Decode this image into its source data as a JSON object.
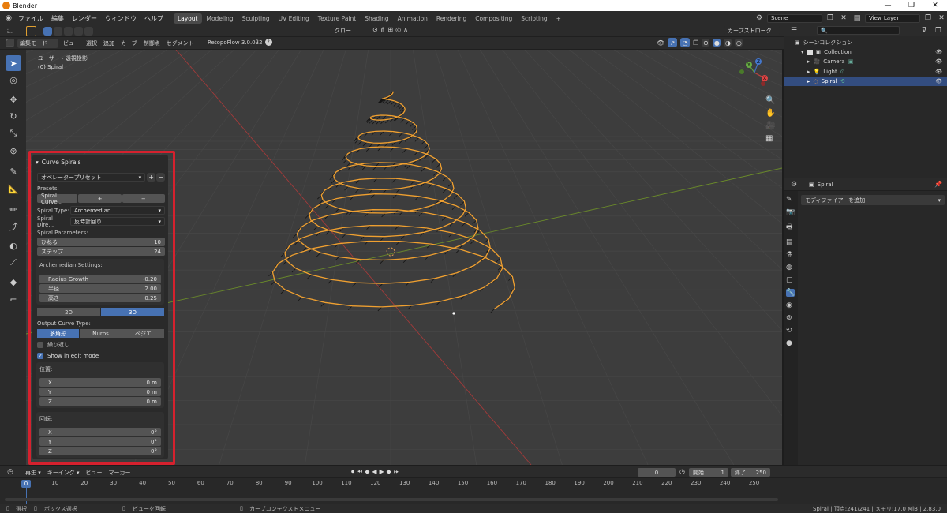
{
  "window": {
    "title": "Blender",
    "minimize": "—",
    "maximize": "❐",
    "close": "✕"
  },
  "menus": [
    "ファイル",
    "編集",
    "レンダー",
    "ウィンドウ",
    "ヘルプ"
  ],
  "workspaces": [
    "Layout",
    "Modeling",
    "Sculpting",
    "UV Editing",
    "Texture Paint",
    "Shading",
    "Animation",
    "Rendering",
    "Compositing",
    "Scripting",
    "+"
  ],
  "scene": {
    "label": "Scene",
    "view_layer": "View Layer"
  },
  "viewport_header": {
    "mode": "編集モード",
    "menus": [
      "ビュー",
      "選択",
      "追加",
      "カーブ",
      "制御点",
      "セグメント"
    ],
    "addon": "RetopoFlow 3.0.0β2",
    "help": "?",
    "transform": "グロー...",
    "tilt": "カーブストローク"
  },
  "viewport": {
    "view_name": "ユーザー・透視投影",
    "object": "(0) Spiral",
    "axes": {
      "x": "X",
      "y": "Y",
      "z": "Z"
    }
  },
  "operator_panel": {
    "title": "Curve Spirals",
    "preset_label": "オペレータープリセット",
    "presets_label": "Presets:",
    "preset_value": "Spiral Curve...",
    "preset_add": "+",
    "preset_remove": "−",
    "spiral_type_label": "Spiral Type:",
    "spiral_type": "Archemedian",
    "spiral_dir_label": "Spiral Dire...",
    "spiral_dir": "反時計回り",
    "params_label": "Spiral Parameters:",
    "turns_label": "ひねる",
    "turns": "10",
    "steps_label": "ステップ",
    "steps": "24",
    "arch_label": "Archemedian Settings:",
    "growth_label": "Radius Growth",
    "growth": "-0.20",
    "radius_label": "半径",
    "radius": "2.00",
    "height_label": "高さ",
    "height": "0.25",
    "mode_2d": "2D",
    "mode_3d": "3D",
    "output_label": "Output Curve Type:",
    "out_poly": "多角形",
    "out_nurbs": "Nurbs",
    "out_bezier": "ベジエ",
    "cyclic_label": "繰り返し",
    "show_edit_label": "Show in edit mode",
    "location_label": "位置:",
    "loc": [
      {
        "k": "X",
        "v": "0 m"
      },
      {
        "k": "Y",
        "v": "0 m"
      },
      {
        "k": "Z",
        "v": "0 m"
      }
    ],
    "rotation_label": "回転:",
    "rot": [
      {
        "k": "X",
        "v": "0°"
      },
      {
        "k": "Y",
        "v": "0°"
      },
      {
        "k": "Z",
        "v": "0°"
      }
    ]
  },
  "outliner": {
    "root": "シーンコレクション",
    "items": [
      {
        "name": "Collection"
      },
      {
        "name": "Camera"
      },
      {
        "name": "Light"
      },
      {
        "name": "Spiral"
      }
    ]
  },
  "properties": {
    "object": "Spiral",
    "add_modifier": "モディファイアーを追加"
  },
  "timeline": {
    "menus": [
      "再生",
      "キーイング",
      "ビュー",
      "マーカー"
    ],
    "current": "0",
    "start_label": "開始",
    "start": "1",
    "end_label": "終了",
    "end": "250",
    "ticks": [
      "0",
      "10",
      "20",
      "30",
      "40",
      "50",
      "60",
      "70",
      "80",
      "90",
      "100",
      "110",
      "120",
      "130",
      "140",
      "150",
      "160",
      "170",
      "180",
      "190",
      "200",
      "210",
      "220",
      "230",
      "240",
      "250"
    ]
  },
  "status": {
    "select": "選択",
    "box": "ボックス選択",
    "rotate": "ビューを回転",
    "context": "カーブコンテクストメニュー",
    "info": "Spiral | 頂点:241/241 | メモリ:17.0 MiB | 2.83.0"
  },
  "colors": {
    "accent": "#4772b3",
    "spiral": "#f0a030",
    "highlight": "#d5212e"
  }
}
